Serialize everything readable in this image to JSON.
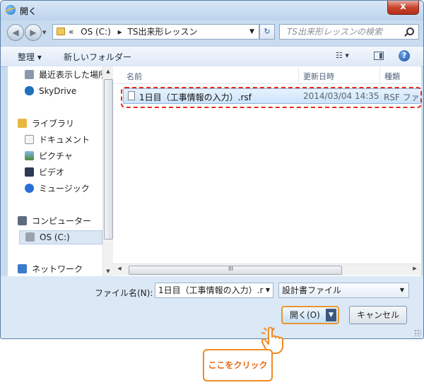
{
  "window": {
    "title": "開く",
    "close_symbol": "x"
  },
  "navbar": {
    "back_symbol": "◀",
    "forward_symbol": "▶",
    "address_prefix": "«",
    "address_drive": "OS (C:)",
    "address_sep": "▸",
    "address_folder": "TS出来形レッスン",
    "search_placeholder": "TS出来形レッスンの検索"
  },
  "toolbar": {
    "organize": "整理 ▾",
    "new_folder": "新しいフォルダー",
    "view_symbol": "☷ ▾",
    "help_symbol": "?"
  },
  "nav_pane": {
    "items": [
      {
        "label": "最近表示した場所",
        "icon": "recent-places-icon"
      },
      {
        "label": "SkyDrive",
        "icon": "skydrive-icon"
      },
      {
        "label": "ライブラリ",
        "icon": "library-icon"
      },
      {
        "label": "ドキュメント",
        "icon": "documents-icon"
      },
      {
        "label": "ピクチャ",
        "icon": "pictures-icon"
      },
      {
        "label": "ビデオ",
        "icon": "video-icon"
      },
      {
        "label": "ミュージック",
        "icon": "music-icon"
      },
      {
        "label": "コンピューター",
        "icon": "computer-icon"
      },
      {
        "label": "OS (C:)",
        "icon": "drive-icon"
      },
      {
        "label": "ネットワーク",
        "icon": "network-icon"
      }
    ]
  },
  "file_list": {
    "columns": [
      "名前",
      "更新日時",
      "種類"
    ],
    "files": [
      {
        "name": "1日目（工事情報の入力）.rsf",
        "modified": "2014/03/04 14:35",
        "type": "RSF ファ"
      }
    ]
  },
  "scroll_mid": "III",
  "bottom": {
    "filename_label": "ファイル名(N):",
    "filename_value": "1日目（工事情報の入力）.r",
    "filetype_value": "設計書ファイル",
    "open_label": "開く(O)",
    "cancel_label": "キャンセル"
  },
  "callout": {
    "text": "ここをクリック"
  },
  "colors": {
    "highlight": "#e0301e",
    "callout": "#f08a24",
    "selection": "#cde4fb"
  }
}
